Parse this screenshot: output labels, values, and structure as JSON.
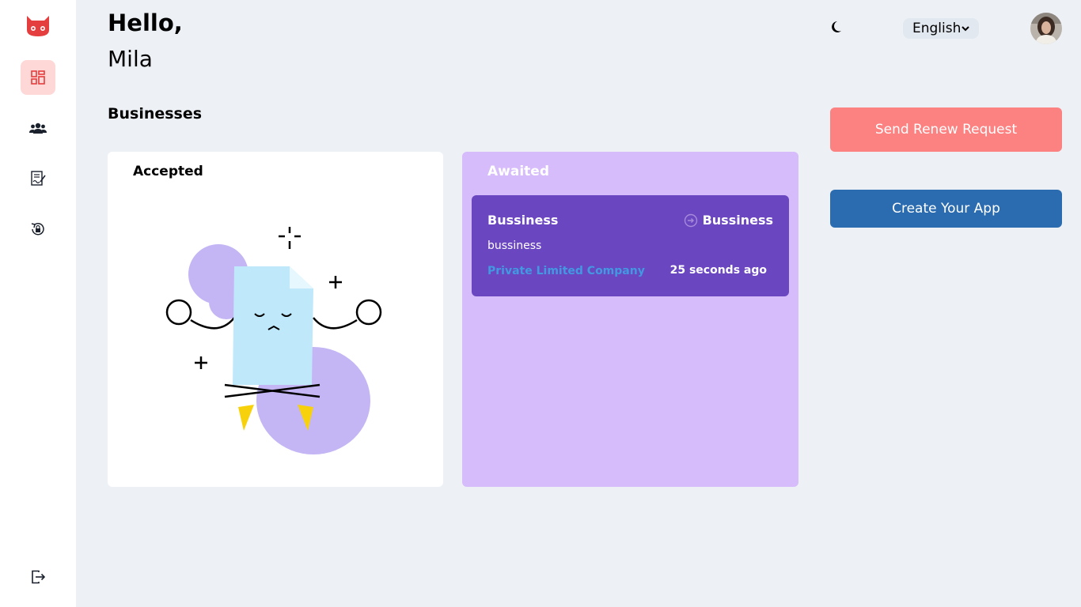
{
  "header": {
    "greeting": "Hello,",
    "user_name": "Mila",
    "language": "English"
  },
  "sidebar": {
    "items": [
      {
        "icon": "dashboard-icon",
        "active": true
      },
      {
        "icon": "users-icon",
        "active": false
      },
      {
        "icon": "contract-icon",
        "active": false
      },
      {
        "icon": "lock-reset-icon",
        "active": false
      }
    ],
    "logout_icon": "logout-icon"
  },
  "main": {
    "section_title": "Businesses",
    "accepted": {
      "title": "Accepted"
    },
    "awaited": {
      "title": "Awaited",
      "items": [
        {
          "name": "Bussiness",
          "label": "Bussiness",
          "description": "bussiness",
          "type": "Private Limited Company",
          "time": "25 seconds ago"
        }
      ]
    }
  },
  "actions": {
    "renew_label": "Send Renew Request",
    "create_label": "Create Your App"
  },
  "colors": {
    "accent_red": "#fc8181",
    "accent_blue": "#2b6cb0",
    "awaited_bg": "#d6bcfa",
    "business_card": "#6b46c1"
  }
}
